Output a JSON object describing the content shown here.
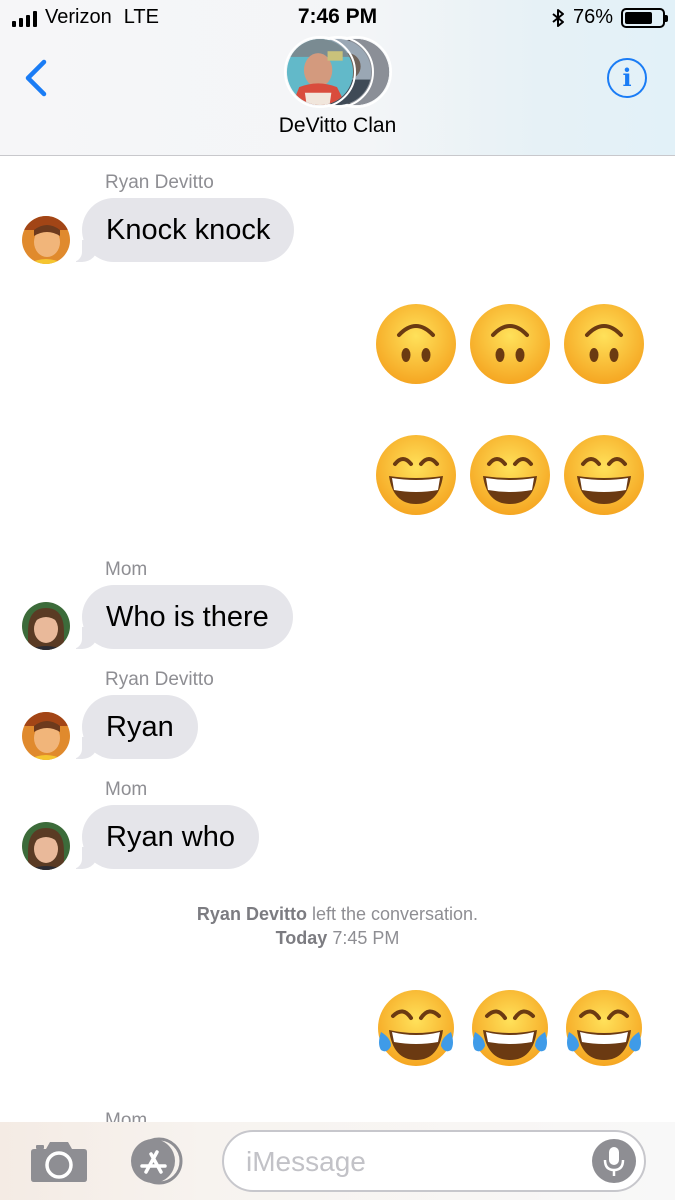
{
  "status_bar": {
    "carrier": "Verizon",
    "network": "LTE",
    "time": "7:46 PM",
    "battery_percent": "76%",
    "battery_level": 0.76,
    "icons": [
      "signal-bars-icon",
      "bluetooth-icon",
      "battery-icon"
    ]
  },
  "header": {
    "back_icon": "chevron-left-icon",
    "title": "DeVitto Clan",
    "info_icon": "info-icon",
    "info_glyph": "i"
  },
  "messages": [
    {
      "type": "incoming",
      "sender": "Ryan Devitto",
      "text": "Knock knock"
    },
    {
      "type": "outgoing-emoji",
      "emoji": [
        "upside-down-face",
        "upside-down-face",
        "upside-down-face"
      ]
    },
    {
      "type": "outgoing-emoji",
      "emoji": [
        "grinning-face",
        "grinning-face",
        "grinning-face"
      ]
    },
    {
      "type": "incoming",
      "sender": "Mom",
      "text": "Who is there"
    },
    {
      "type": "incoming",
      "sender": "Ryan Devitto",
      "text": "Ryan"
    },
    {
      "type": "incoming",
      "sender": "Mom",
      "text": "Ryan who"
    },
    {
      "type": "outgoing-emoji",
      "emoji": [
        "tears-of-joy",
        "tears-of-joy",
        "tears-of-joy"
      ]
    }
  ],
  "system_note": {
    "name": "Ryan Devitto",
    "action": " left the conversation.",
    "day": "Today",
    "time": " 7:45 PM"
  },
  "partial_sender": "Mom",
  "input_bar": {
    "placeholder": "iMessage",
    "value": "",
    "icons": [
      "camera-icon",
      "app-store-icon",
      "microphone-icon"
    ]
  },
  "colors": {
    "accent": "#1a7cf5",
    "incoming_bubble": "#e5e5ea",
    "secondary_text": "#8e8e93"
  }
}
